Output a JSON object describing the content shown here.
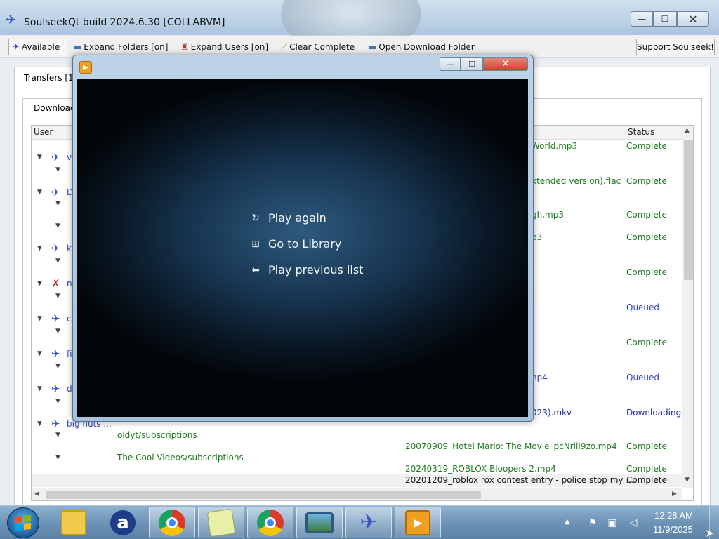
{
  "window": {
    "title": "SoulseekQt build 2024.6.30 [COLLABVM]",
    "min_glyph": "—",
    "max_glyph": "☐",
    "close_glyph": "✕"
  },
  "toolbar": {
    "available": "Available",
    "expand_folders": "Expand Folders [on]",
    "expand_users": "Expand Users [on]",
    "clear_complete": "Clear Complete",
    "open_download_folder": "Open Download Folder",
    "support": "Support Soulseek!"
  },
  "tabs": {
    "transfers": "Transfers [1",
    "downloads": "Download"
  },
  "list": {
    "headers": {
      "user": "User",
      "status": "Status"
    },
    "users": [
      {
        "name": "v"
      },
      {
        "name": "D"
      },
      {
        "name": "k"
      },
      {
        "name": "n"
      },
      {
        "name": "c"
      },
      {
        "name": "fi"
      },
      {
        "name": "d"
      },
      {
        "name": "big nuts ..."
      }
    ],
    "folders": [
      "oldyt/subscriptions",
      "The Cool Videos/subscriptions"
    ],
    "files": [
      {
        "file": "World.mp3",
        "status": "Complete"
      },
      {
        "file": "xtended version).flac",
        "status": "Complete"
      },
      {
        "file": "gh.mp3",
        "status": "Complete"
      },
      {
        "file": "p3",
        "status": "Complete"
      },
      {
        "file": "",
        "status": "Complete"
      },
      {
        "file": "",
        "status": "Queued"
      },
      {
        "file": "",
        "status": "Complete"
      },
      {
        "file": "np4",
        "status": "Queued"
      },
      {
        "file": "023).mkv",
        "status": "Downloading"
      },
      {
        "file": "20070909_Hotel Mario: The Movie_pcNriiI9zo.mp4",
        "status": "Complete"
      },
      {
        "file": "20240319_ROBLOX Bloopers 2.mp4",
        "status": "Complete"
      },
      {
        "file": "20201209_roblox rox contest entry - police stop my ...",
        "status": "Complete"
      }
    ]
  },
  "player": {
    "menu": [
      {
        "icon": "replay-icon",
        "label": "Play again"
      },
      {
        "icon": "library-icon",
        "label": "Go to Library"
      },
      {
        "icon": "back-arrow-icon",
        "label": "Play previous list"
      }
    ]
  },
  "taskbar": {
    "time": "12:28 AM",
    "date": "11/9/2025"
  },
  "colors": {
    "complete": "#1f7a1f",
    "queued": "#3a4ab8",
    "downloading": "#1a2a9c"
  }
}
